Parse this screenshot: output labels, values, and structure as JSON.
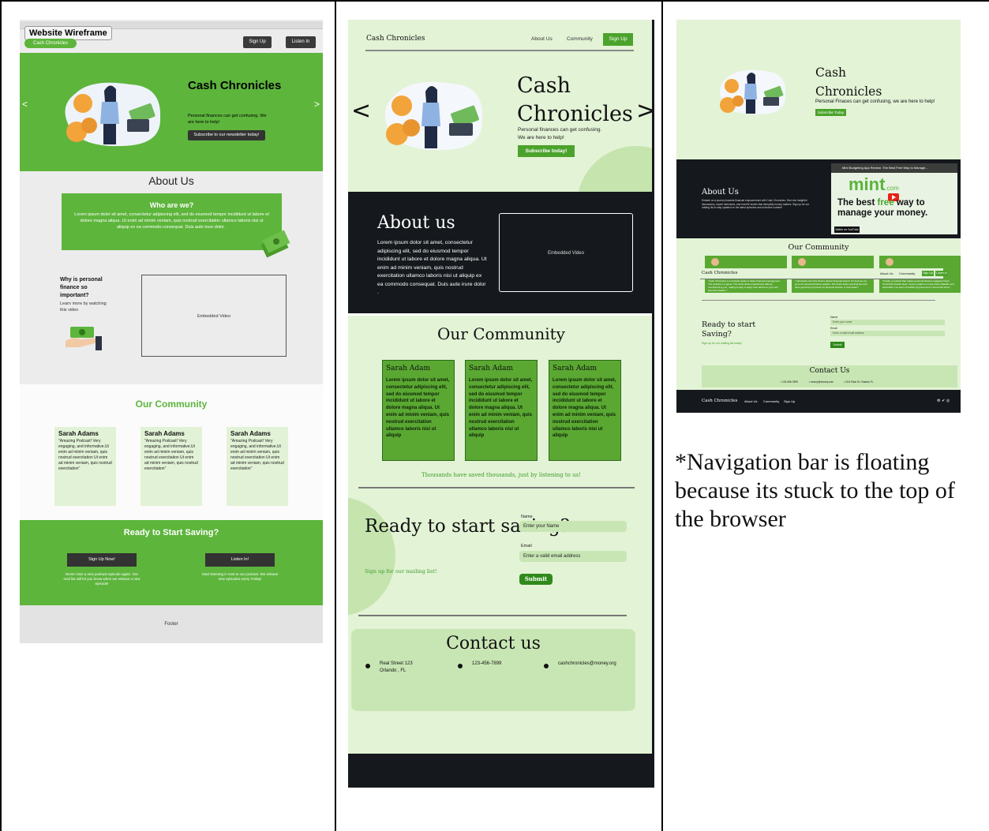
{
  "panel1": {
    "wireframe_label": "Website Wireframe",
    "brand": "Cash Chronicles",
    "nav_signup": "Sign Up",
    "nav_listen": "Listen In",
    "hero_title": "Cash Chronicles",
    "hero_sub": "Personal finances can get confusing. We are here to help!",
    "hero_cta": "Subscribe to our newsletter today!",
    "prev_arrow": "<",
    "next_arrow": ">",
    "about_heading": "About Us",
    "who_heading": "Who are we?",
    "who_text": "Lorem ipsum dolor sit amet, consectetur adipiscing elit, sed do eiusmod tempor incididunt ut labore et dolore magna aliqua. Ut enim ad minim veniam, quis nostrud exercitation ullamco laboris nisi ut aliquip ex ea commodo consequat. Duis aute irure dolor .",
    "why_heading": "Why is personal finance so important?",
    "why_sub": "Learn more by watching this video",
    "video_label": "Embedded Video",
    "community_heading": "Our Community",
    "cards": [
      {
        "name": "Sarah Adams",
        "quote": "\"Amazing Podcast! Very engaging, and informative.Ut enim ad minim veniam, quis nostrud exercitation Ut enim ad minim veniam, quis nostrud exercitation\""
      },
      {
        "name": "Sarah Adams",
        "quote": "\"Amazing Podcast! Very engaging, and informative.Ut enim ad minim veniam, quis nostrud exercitation Ut enim ad minim veniam, quis nostrud exercitation\""
      },
      {
        "name": "Sarah Adams",
        "quote": "\"Amazing Podcast! Very engaging, and informative.Ut enim ad minim veniam, quis nostrud exercitation Ut enim ad minim veniam, quis nostrud exercitation\""
      }
    ],
    "ready_heading": "Ready to Start Saving?",
    "signup_now": "Sign Up Now!",
    "signup_text": "Never miss a new podcast episode again. Our mail list will let you know when we release a new episode!",
    "listen_btn": "Listen In!",
    "listen_text": "Start listening in now to our podcast. We release new episodes every Friday!",
    "footer": "Footer"
  },
  "panel2": {
    "brand": "Cash Chronicles",
    "nav_about": "About Us",
    "nav_community": "Community",
    "nav_signup": "Sign Up",
    "prev_arrow": "<",
    "next_arrow": ">",
    "hero_title": "Cash Chronicles",
    "hero_sub": "Personal finances can get confusing. We are here to help!",
    "hero_cta": "Subscribe today!",
    "about_heading": "About us",
    "about_text": "Lorem ipsum dolor sit amet, consectetur adipiscing elit, sed do eiusmod tempor incididunt ut labore et dolore magna aliqua. Ut enim ad minim veniam, quis nostrud exercitation ullamco laboris nisi ut aliquip ex ea commodo consequat. Duis aute irure dolor .",
    "video_label": "Embedded Video",
    "community_heading": "Our Community",
    "cards": [
      {
        "name": "Sarah Adam",
        "text": "Lorem ipsum dolor sit amet, consectetur adipiscing elit, sed do eiusmod tempor incididunt ut labore et dolore magna aliqua. Ut enim ad minim veniam, quis nostrud exercitation ullamco laboris nisi ut aliquip"
      },
      {
        "name": "Sarah Adam",
        "text": "Lorem ipsum dolor sit amet, consectetur adipiscing elit, sed do eiusmod tempor incididunt ut labore et dolore magna aliqua. Ut enim ad minim veniam, quis nostrud exercitation ullamco laboris nisi ut aliquip"
      },
      {
        "name": "Sarah Adam",
        "text": "Lorem ipsum dolor sit amet, consectetur adipiscing elit, sed do eiusmod tempor incididunt ut labore et dolore magna aliqua. Ut enim ad minim veniam, quis nostrud exercitation ullamco laboris nisi ut aliquip"
      }
    ],
    "thousands": "Thousands have saved thousands, just by listening to us!",
    "ready_heading": "Ready to start saving?",
    "ready_sub": "Sign up for our mailing list!",
    "name_label": "Name",
    "name_placeholder": "Enter your Name",
    "email_label": "Email",
    "email_placeholder": "Enter a valid email address",
    "submit": "Submit",
    "contact_heading": "Contact us",
    "address": "Real Street 123 Orlando , FL",
    "phone": "123-456-7899",
    "email": "cashchronicles@money.org"
  },
  "panel3": {
    "hero_title": "Cash Chronicles",
    "hero_sub": "Personal Finaces can get confusing, we are here to help!",
    "hero_cta": "Subscribe Today",
    "about_heading": "About Us",
    "about_text": "Embark on a journey towards financial empowerment with Cash Chronicles. Dive into insightful discussions, expert interviews, and real-life stories that demystify money matters. Sign up for our mailing list to stay updated on the latest episodes and exclusive content!",
    "video_title": "Mint Budgeting App Review: The Best Free Way to Manage...",
    "video_brand": "mint",
    "video_brand_suffix": ".com",
    "video_tag_a": "The best",
    "video_tag_free": "free",
    "video_tag_b": "way to manage your money.",
    "watch_on": "Watch on YouTube",
    "community_heading": "Our Community",
    "card_texts": [
      "\"Cash Chronicles is a fantastic guide to better financial management. The podcast is a game. The hosts share practical tips without overwhelming you, making it easy to apply their advice to your own financial situation.\"",
      "\"I absolutely love this show's perfect financial advice! It's become my go-to for personal finance wisdom. The hosts share practical tips that have genuinely improved my financial outlook. A must-listen!\"",
      "\"Finally, a podcast that makes personal finance engaging! Cash Chronicles breaks down money matters in a way that's relatable and actionable. I've seen incredible progress since I found this show.\""
    ],
    "overlay_brand": "Cash Chronicles",
    "overlay_about": "About Us",
    "overlay_community": "Community",
    "overlay_signup": "Sign Up",
    "overlay_listen": "Listen In",
    "ready_heading": "Ready to start Saving?",
    "ready_sub": "Sign up for our mailing list today!",
    "name_label": "Name",
    "name_placeholder": "Enter your name",
    "email_label": "Email",
    "email_placeholder": "Enter a valid email address",
    "submit": "Submit",
    "contact_heading": "Contact Us",
    "contact_phone": "• 123-456-7899",
    "contact_email": "• money@money.com",
    "contact_address": "• 1111 Real St. Orlando FL",
    "footer_brand": "Cash Chronicles",
    "footer_about": "About Us",
    "footer_community": "Community",
    "footer_signup": "Sign Up",
    "social_icons": "⚙ ✔ ◎"
  },
  "note": "*Navigation bar is floating because its stuck to the top of the browser",
  "colors": {
    "green": "#5db53c",
    "dark": "#15181c",
    "light_green": "#e3f3d6"
  }
}
